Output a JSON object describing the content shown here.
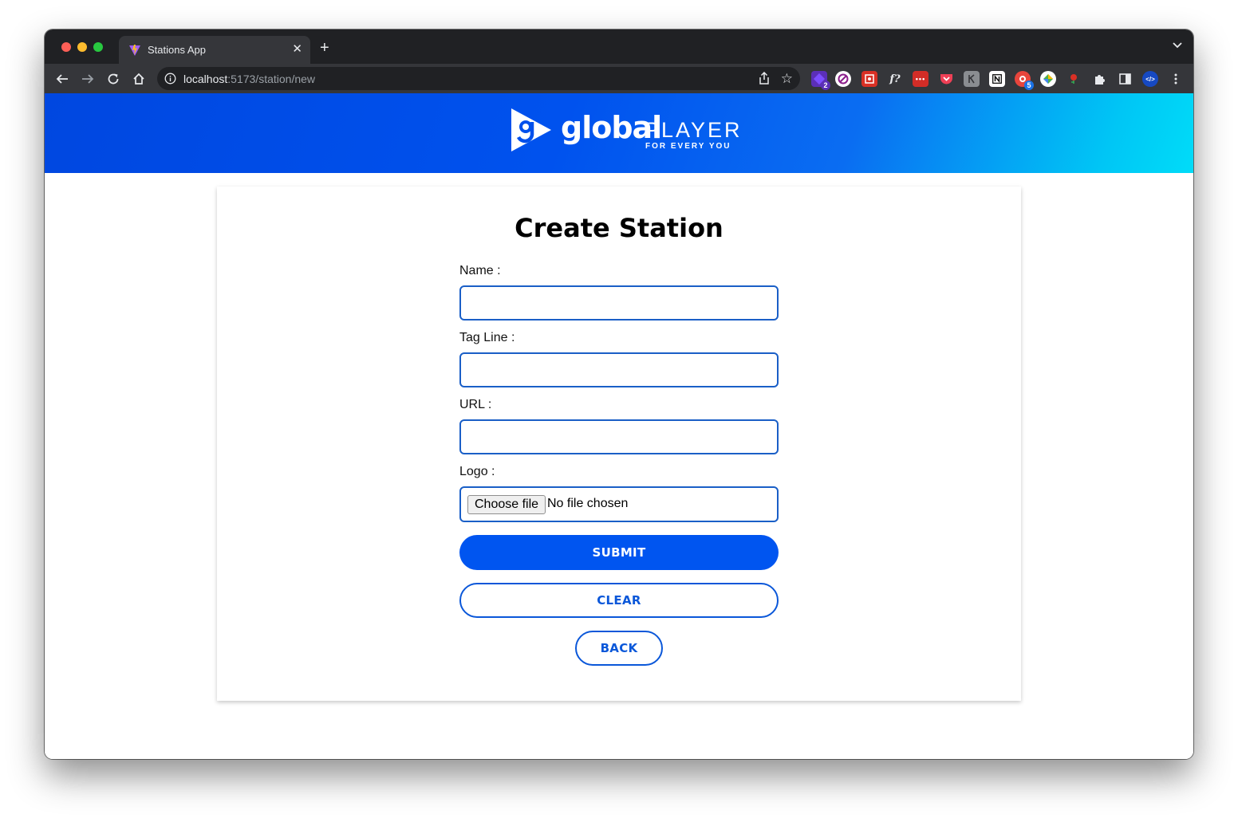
{
  "browser": {
    "tab_title": "Stations App",
    "tab_close": "✕",
    "new_tab": "+",
    "url_host": "localhost",
    "url_rest": ":5173/station/new",
    "extensions": [
      {
        "name": "puzzle-ext",
        "badge": "2",
        "color": "#5b2fb8"
      },
      {
        "name": "block-ext",
        "badge": "",
        "color": "#ffffff"
      },
      {
        "name": "red-ext",
        "badge": "",
        "color": "#d93025"
      },
      {
        "name": "font-ext",
        "badge": "",
        "color": "#35363a"
      },
      {
        "name": "lastpass-ext",
        "badge": "",
        "color": "#d32d27"
      },
      {
        "name": "pocket-ext",
        "badge": "",
        "color": "#ef4056"
      },
      {
        "name": "gray-ext",
        "badge": "",
        "color": "#8a8d91"
      },
      {
        "name": "notion-ext",
        "badge": "",
        "color": "#ffffff"
      },
      {
        "name": "grammar-ext",
        "badge": "5",
        "color": "#e8453c"
      },
      {
        "name": "color-ext",
        "badge": "",
        "color": "#ffffff"
      },
      {
        "name": "rose-ext",
        "badge": "",
        "color": "#35363a"
      }
    ],
    "font_ext_label": "f?"
  },
  "header": {
    "brand_word": "global",
    "brand_player": "PLAYER",
    "brand_tagline": "FOR EVERY YOU",
    "brand_color": "#0052ee"
  },
  "form": {
    "title": "Create Station",
    "name_label": "Name :",
    "name_value": "",
    "tagline_label": "Tag Line :",
    "tagline_value": "",
    "url_label": "URL :",
    "url_value": "",
    "logo_label": "Logo :",
    "file_button": "Choose file",
    "file_status": "No file chosen",
    "submit_label": "SUBMIT",
    "clear_label": "CLEAR",
    "back_label": "BACK",
    "accent_color": "#0055f0"
  }
}
